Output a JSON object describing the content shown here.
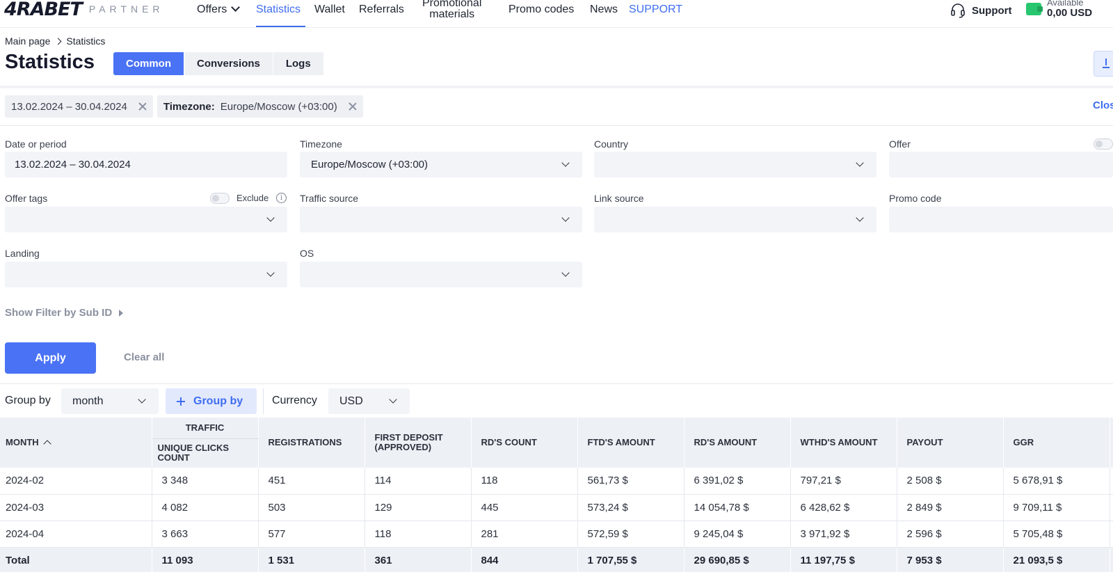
{
  "brand": {
    "logo_text": "4RABET",
    "partner_text": "PARTNER"
  },
  "nav": {
    "offers": "Offers",
    "statistics": "Statistics",
    "wallet": "Wallet",
    "referrals": "Referrals",
    "promo_line1": "Promotional",
    "promo_line2": "materials",
    "promo_codes": "Promo codes",
    "news": "News",
    "support_link": "SUPPORT"
  },
  "account": {
    "support": "Support",
    "available_label": "Available",
    "balance": "0,00 USD"
  },
  "breadcrumb": {
    "home": "Main page",
    "current": "Statistics"
  },
  "page_title": "Statistics",
  "tabs": [
    "Common",
    "Conversions",
    "Logs"
  ],
  "active_tab": "Common",
  "chips": {
    "period": "13.02.2024 – 30.04.2024",
    "timezone_label": "Timezone:",
    "timezone_value": "Europe/Moscow (+03:00)",
    "close": "Close"
  },
  "filters": {
    "date_label": "Date or period",
    "date_value": "13.02.2024 – 30.04.2024",
    "timezone_label": "Timezone",
    "timezone_value": "Europe/Moscow (+03:00)",
    "country_label": "Country",
    "offer_label": "Offer",
    "offer_tags_label": "Offer tags",
    "exclude_label": "Exclude",
    "traffic_source_label": "Traffic source",
    "link_source_label": "Link source",
    "promo_code_label": "Promo code",
    "landing_label": "Landing",
    "os_label": "OS",
    "subid_link": "Show Filter by Sub ID",
    "apply": "Apply",
    "clear_all": "Clear all"
  },
  "grouping": {
    "group_by_label": "Group by",
    "group_by_value": "month",
    "add_group_by": "Group by",
    "currency_label": "Currency",
    "currency_value": "USD"
  },
  "table": {
    "month_header": "MONTH",
    "traffic_header": "TRAFFIC",
    "columns": [
      "UNIQUE CLICKS COUNT",
      "REGISTRATIONS",
      "FIRST DEPOSIT (APPROVED)",
      "RD'S COUNT",
      "FTD'S AMOUNT",
      "RD'S AMOUNT",
      "WTHD'S AMOUNT",
      "PAYOUT",
      "GGR"
    ],
    "rows": [
      [
        "2024-02",
        "3 348",
        "451",
        "114",
        "118",
        "561,73 $",
        "6 391,02 $",
        "797,21 $",
        "2 508 $",
        "5 678,91 $"
      ],
      [
        "2024-03",
        "4 082",
        "503",
        "129",
        "445",
        "573,24 $",
        "14 054,78 $",
        "6 428,62 $",
        "2 849 $",
        "9 709,11 $"
      ],
      [
        "2024-04",
        "3 663",
        "577",
        "118",
        "281",
        "572,59 $",
        "9 245,04 $",
        "3 971,92 $",
        "2 596 $",
        "5 705,48 $"
      ]
    ],
    "total": [
      "Total",
      "11 093",
      "1 531",
      "361",
      "844",
      "1 707,55 $",
      "29 690,85 $",
      "11 197,75 $",
      "7 953 $",
      "21 093,5 $"
    ]
  },
  "colors": {
    "accent": "#4a72f5",
    "wallet_green": "#28c76f",
    "muted": "#8a90a0"
  }
}
